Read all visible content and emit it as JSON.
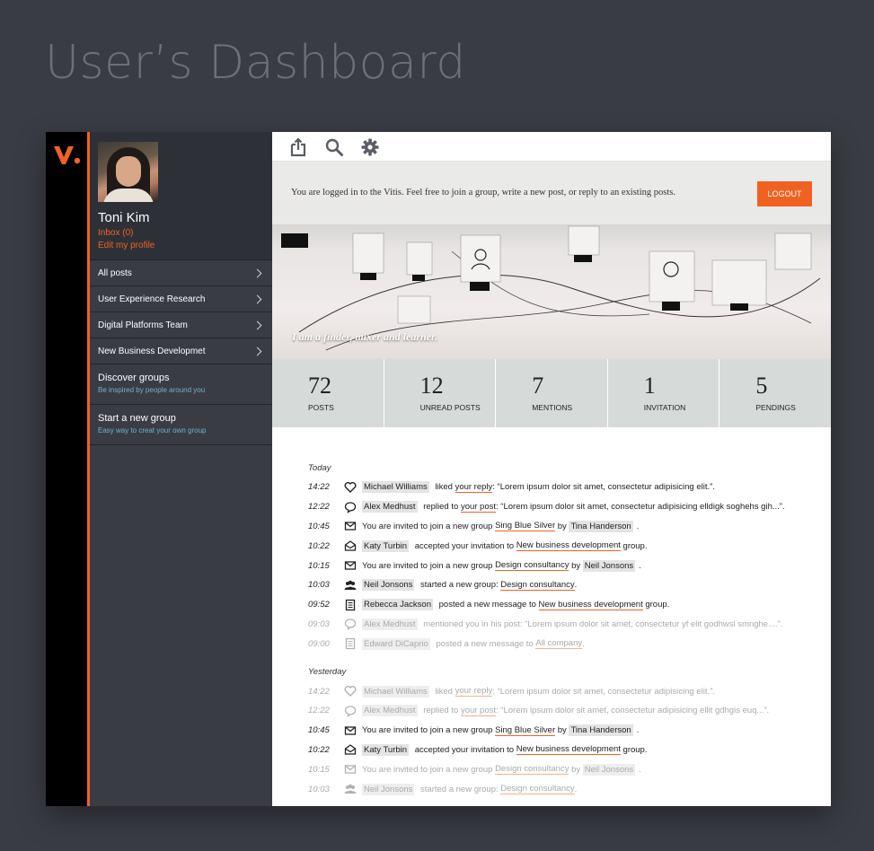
{
  "page_title": "User’s Dashboard",
  "colors": {
    "accent": "#f16222",
    "sidebar_bg": "#3a3c44",
    "stats_bg": "#d6dbda"
  },
  "sidebar": {
    "user_name": "Toni Kim",
    "inbox": "Inbox (0)",
    "edit_profile": "Edit my profile",
    "nav": [
      {
        "label": "All posts"
      },
      {
        "label": "User Experience Research"
      },
      {
        "label": "Digital Platforms Team"
      },
      {
        "label": "New Business Developmet"
      }
    ],
    "discover": {
      "title": "Discover groups",
      "subtitle": "Be inspired by people around you"
    },
    "start": {
      "title": "Start a new group",
      "subtitle": "Easy way to creat your own group"
    }
  },
  "toolbar": {
    "icons": [
      "share-icon",
      "search-icon",
      "gear-icon"
    ]
  },
  "hero": {
    "notice": "You are logged in to the Vitis. Feel free to join a group, write a new post, or reply to an existing posts.",
    "logout": "LOGOUT",
    "tagline": "I am a finder, mixer and learner."
  },
  "stats": [
    {
      "num": "72",
      "label": "POSTS"
    },
    {
      "num": "12",
      "label": "UNREAD POSTS"
    },
    {
      "num": "7",
      "label": "MENTIONS"
    },
    {
      "num": "1",
      "label": "INVITATION"
    },
    {
      "num": "5",
      "label": "PENDINGS"
    }
  ],
  "feed": {
    "today_label": "Today",
    "yesterday_label": "Yesterday",
    "today": [
      {
        "time": "14:22",
        "icon": "heart-icon",
        "dim": false,
        "parts": [
          [
            "who",
            "Michael Williams"
          ],
          [
            "t",
            " liked "
          ],
          [
            "lnk",
            "your reply"
          ],
          [
            "t",
            ": “Lorem ipsum dolor sit amet, consectetur adipisicing elit.”."
          ]
        ]
      },
      {
        "time": "12:22",
        "icon": "comment-icon",
        "dim": false,
        "parts": [
          [
            "who",
            "Alex Medhust"
          ],
          [
            "t",
            " replied to "
          ],
          [
            "lnk",
            "your post"
          ],
          [
            "t",
            ": “Lorem ipsum dolor sit amet, consectetur adipisicing elldigk soghehs gih...”."
          ]
        ]
      },
      {
        "time": "10:45",
        "icon": "mail-icon",
        "dim": false,
        "parts": [
          [
            "t",
            "You are invited to join a new group "
          ],
          [
            "lnk",
            "Sing Blue Silver"
          ],
          [
            "t",
            " by "
          ],
          [
            "who",
            "Tina Handerson"
          ],
          [
            "t",
            "."
          ]
        ]
      },
      {
        "time": "10:22",
        "icon": "mail-open-icon",
        "dim": false,
        "parts": [
          [
            "who",
            "Katy Turbin"
          ],
          [
            "t",
            " accepted your invitation to "
          ],
          [
            "lnk",
            "New business development"
          ],
          [
            "t",
            " group."
          ]
        ]
      },
      {
        "time": "10:15",
        "icon": "mail-icon",
        "dim": false,
        "parts": [
          [
            "t",
            "You are invited to join a new group "
          ],
          [
            "lnk",
            "Design consultancy"
          ],
          [
            "t",
            " by "
          ],
          [
            "who",
            "Neil Jonsons"
          ],
          [
            "t",
            "."
          ]
        ]
      },
      {
        "time": "10:03",
        "icon": "group-icon",
        "dim": false,
        "parts": [
          [
            "who",
            "Neil Jonsons"
          ],
          [
            "t",
            " started a new group: "
          ],
          [
            "lnk",
            "Design consultancy"
          ],
          [
            "t",
            "."
          ]
        ]
      },
      {
        "time": "09:52",
        "icon": "document-icon",
        "dim": false,
        "parts": [
          [
            "who",
            "Rebecca Jackson"
          ],
          [
            "t",
            " posted a new message to "
          ],
          [
            "lnk",
            "New business development"
          ],
          [
            "t",
            " group."
          ]
        ]
      },
      {
        "time": "09:03",
        "icon": "comment-icon",
        "dim": true,
        "parts": [
          [
            "who",
            "Alex Medhust"
          ],
          [
            "t",
            " mentioned you in his post: “Lorem ipsum dolor sit amet, consectetur yf elit godhwsl smnghe....”."
          ]
        ]
      },
      {
        "time": "09:00",
        "icon": "document-icon",
        "dim": true,
        "parts": [
          [
            "who",
            "Edward DiCaprio"
          ],
          [
            "t",
            " posted a new message to "
          ],
          [
            "lnk",
            "All company"
          ],
          [
            "t",
            "."
          ]
        ]
      }
    ],
    "yesterday": [
      {
        "time": "14:22",
        "icon": "heart-icon",
        "dim": true,
        "parts": [
          [
            "who",
            "Michael Williams"
          ],
          [
            "t",
            " liked "
          ],
          [
            "lnk",
            "your reply"
          ],
          [
            "t",
            ": “Lorem ipsum dolor sit amet, consectetur adipisicing elit.”."
          ]
        ]
      },
      {
        "time": "12:22",
        "icon": "comment-icon",
        "dim": true,
        "parts": [
          [
            "who",
            "Alex Medhust"
          ],
          [
            "t",
            " replied to "
          ],
          [
            "lnk",
            "your post"
          ],
          [
            "t",
            ": “Lorem ipsum dolor sit amet, consectetur adipisicing ellit gdhgis euq...”."
          ]
        ]
      },
      {
        "time": "10:45",
        "icon": "mail-icon",
        "dim": false,
        "parts": [
          [
            "t",
            "You are invited to join a new group "
          ],
          [
            "lnk",
            "Sing Blue Silver"
          ],
          [
            "t",
            " by "
          ],
          [
            "who",
            "Tina Handerson"
          ],
          [
            "t",
            "."
          ]
        ]
      },
      {
        "time": "10:22",
        "icon": "mail-open-icon",
        "dim": false,
        "parts": [
          [
            "who",
            "Katy Turbin"
          ],
          [
            "t",
            " accepted your invitation to "
          ],
          [
            "lnk",
            "New business development"
          ],
          [
            "t",
            " group."
          ]
        ]
      },
      {
        "time": "10:15",
        "icon": "mail-icon",
        "dim": true,
        "parts": [
          [
            "t",
            "You are invited to join a new group "
          ],
          [
            "lnk",
            "Design consultancy"
          ],
          [
            "t",
            " by "
          ],
          [
            "who",
            "Neil Jonsons"
          ],
          [
            "t",
            "."
          ]
        ]
      },
      {
        "time": "10:03",
        "icon": "group-icon",
        "dim": true,
        "parts": [
          [
            "who",
            "Neil Jonsons"
          ],
          [
            "t",
            " started a new group: "
          ],
          [
            "lnk",
            "Design consultancy"
          ],
          [
            "t",
            "."
          ]
        ]
      }
    ]
  }
}
